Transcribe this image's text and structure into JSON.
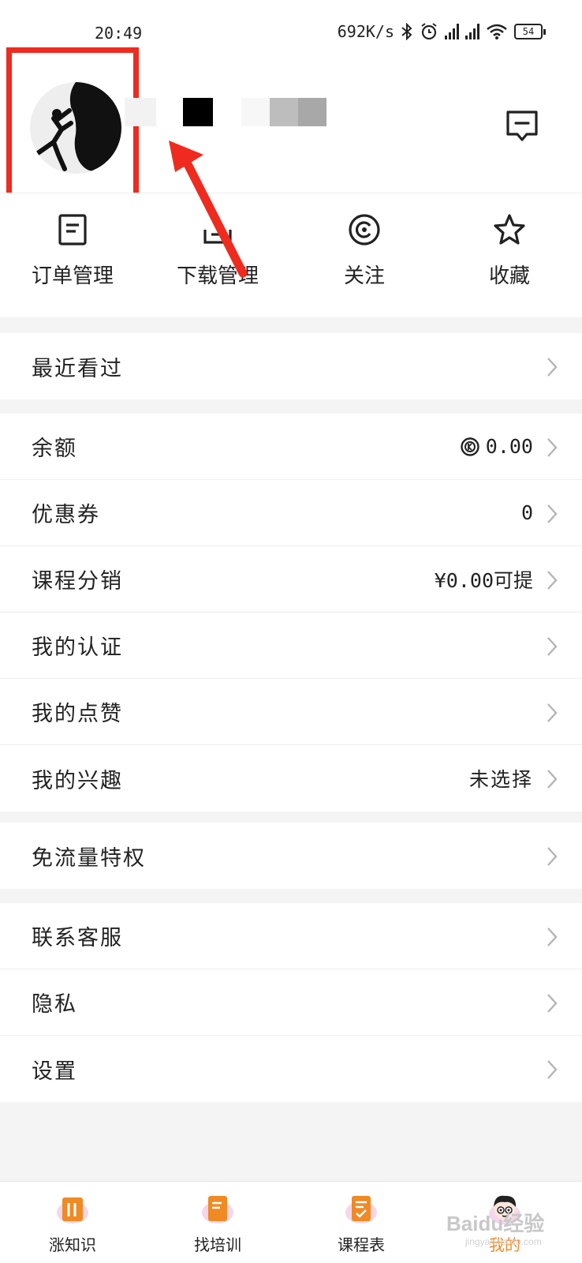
{
  "status": {
    "time": "20:49",
    "speed": "692K/s",
    "battery": "54"
  },
  "quick_actions": [
    {
      "label": "订单管理",
      "icon": "order-icon"
    },
    {
      "label": "下载管理",
      "icon": "download-icon"
    },
    {
      "label": "关注",
      "icon": "follow-icon"
    },
    {
      "label": "收藏",
      "icon": "star-icon"
    }
  ],
  "groups": [
    [
      {
        "label": "最近看过",
        "value": ""
      }
    ],
    [
      {
        "label": "余额",
        "value": "0.00",
        "coin": true
      },
      {
        "label": "优惠券",
        "value": "0"
      },
      {
        "label": "课程分销",
        "value": "¥0.00可提"
      },
      {
        "label": "我的认证",
        "value": ""
      },
      {
        "label": "我的点赞",
        "value": ""
      },
      {
        "label": "我的兴趣",
        "value": "未选择"
      }
    ],
    [
      {
        "label": "免流量特权",
        "value": ""
      }
    ],
    [
      {
        "label": "联系客服",
        "value": ""
      },
      {
        "label": "隐私",
        "value": ""
      },
      {
        "label": "设置",
        "value": ""
      }
    ]
  ],
  "tabs": [
    {
      "label": "涨知识",
      "icon": "knowledge-icon"
    },
    {
      "label": "找培训",
      "icon": "training-icon"
    },
    {
      "label": "课程表",
      "icon": "schedule-icon"
    },
    {
      "label": "我的",
      "icon": "profile-icon",
      "active": true
    }
  ],
  "watermark": {
    "main": "Baidu经验",
    "sub": "jingyan.baidu.com"
  },
  "colors": {
    "accent": "#f08a24",
    "annotation": "#ee2b1e"
  }
}
